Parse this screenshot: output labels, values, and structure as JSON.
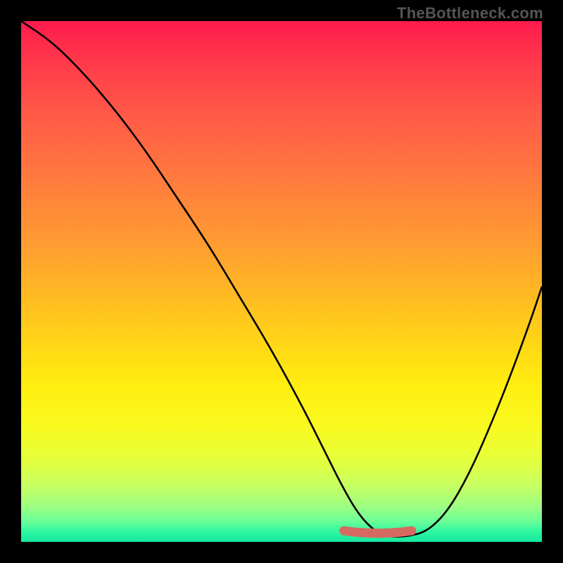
{
  "watermark": "TheBottleneck.com",
  "chart_data": {
    "type": "line",
    "title": "",
    "xlabel": "",
    "ylabel": "",
    "xlim": [
      0,
      100
    ],
    "ylim": [
      0,
      100
    ],
    "series": [
      {
        "name": "bottleneck-curve",
        "x": [
          0,
          6,
          12,
          18,
          24,
          30,
          36,
          42,
          48,
          54,
          58,
          62,
          65,
          68,
          70,
          74,
          78,
          82,
          86,
          90,
          94,
          98,
          100
        ],
        "y": [
          100,
          96,
          90,
          83,
          75,
          66,
          57,
          47,
          37,
          26,
          18,
          10,
          5,
          2,
          1,
          1,
          2,
          6,
          13,
          22,
          32,
          43,
          49
        ]
      }
    ],
    "marker": {
      "name": "minimum-band",
      "x_start": 62,
      "x_end": 75,
      "y": 2,
      "color": "#d66a60"
    },
    "background_gradient": {
      "top": "#ff1a4d",
      "mid1": "#ff9a32",
      "mid2": "#ffee10",
      "bottom": "#14e8a0"
    }
  }
}
